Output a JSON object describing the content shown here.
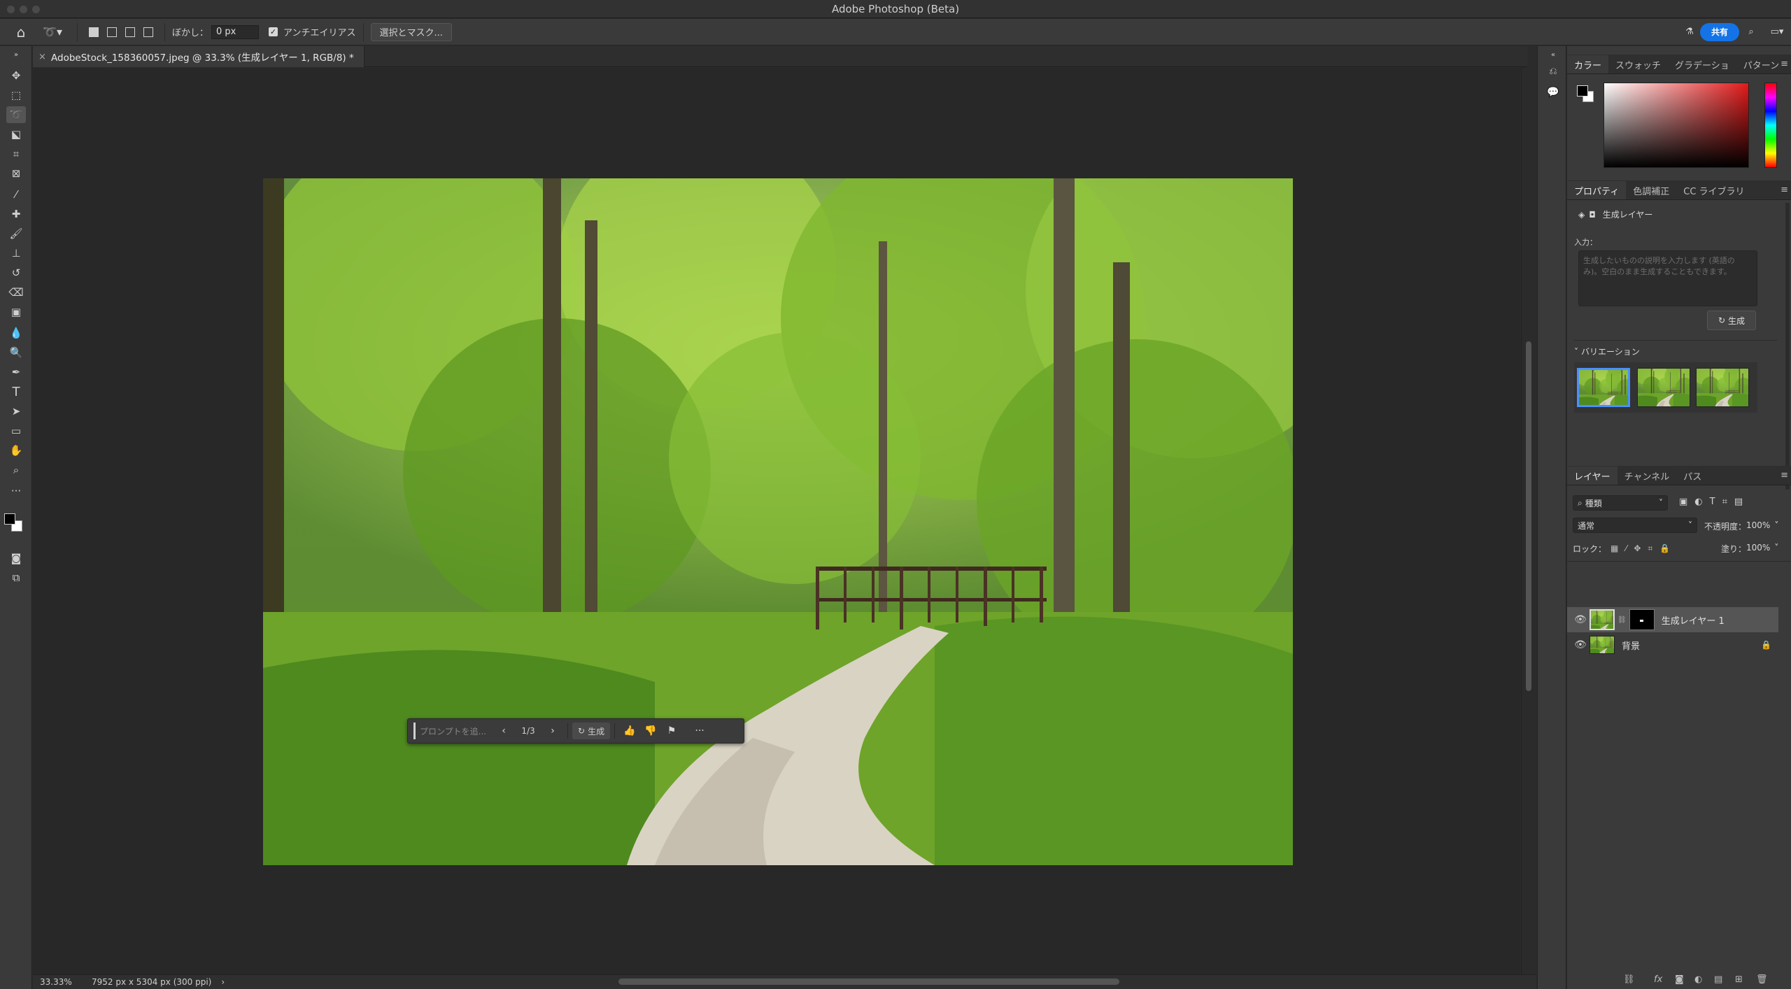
{
  "app": {
    "title": "Adobe Photoshop (Beta)"
  },
  "options_bar": {
    "feather_label": "ぼかし：",
    "feather_value": "0 px",
    "antialias_label": "アンチエイリアス",
    "select_mask_label": "選択とマスク...",
    "share_label": "共有"
  },
  "document": {
    "tab_title": "AdobeStock_158360057.jpeg @ 33.3% (生成レイヤー 1, RGB/8) *",
    "zoom": "33.33%",
    "info": "7952 px x 5304 px (300 ppi)"
  },
  "context_bar": {
    "prompt_placeholder": "プロンプトを追...",
    "page_indicator": "1/3",
    "generate_label": "生成"
  },
  "color_panel": {
    "tabs": [
      "カラー",
      "スウォッチ",
      "グラデーショ",
      "パターン"
    ],
    "active_tab": 0
  },
  "properties_panel": {
    "tabs": [
      "プロパティ",
      "色調補正",
      "CC ライブラリ"
    ],
    "active_tab": 0,
    "layer_type": "生成レイヤー",
    "input_label": "入力：",
    "input_placeholder": "生成したいものの説明を入力します (英語のみ)。空白のまま生成することもできます。",
    "generate_button": "生成",
    "variations_label": "バリエーション"
  },
  "layers_panel": {
    "tabs": [
      "レイヤー",
      "チャンネル",
      "パス"
    ],
    "active_tab": 0,
    "filter_label": "種類",
    "blend_mode": "通常",
    "opacity_label": "不透明度：",
    "opacity_value": "100%",
    "lock_label": "ロック：",
    "fill_label": "塗り：",
    "fill_value": "100%",
    "layers": [
      {
        "name": "生成レイヤー 1",
        "selected": true
      },
      {
        "name": "背景",
        "selected": false,
        "locked": true
      }
    ]
  },
  "colors": {
    "accent": "#1473e6",
    "selection": "#4a90ff"
  }
}
